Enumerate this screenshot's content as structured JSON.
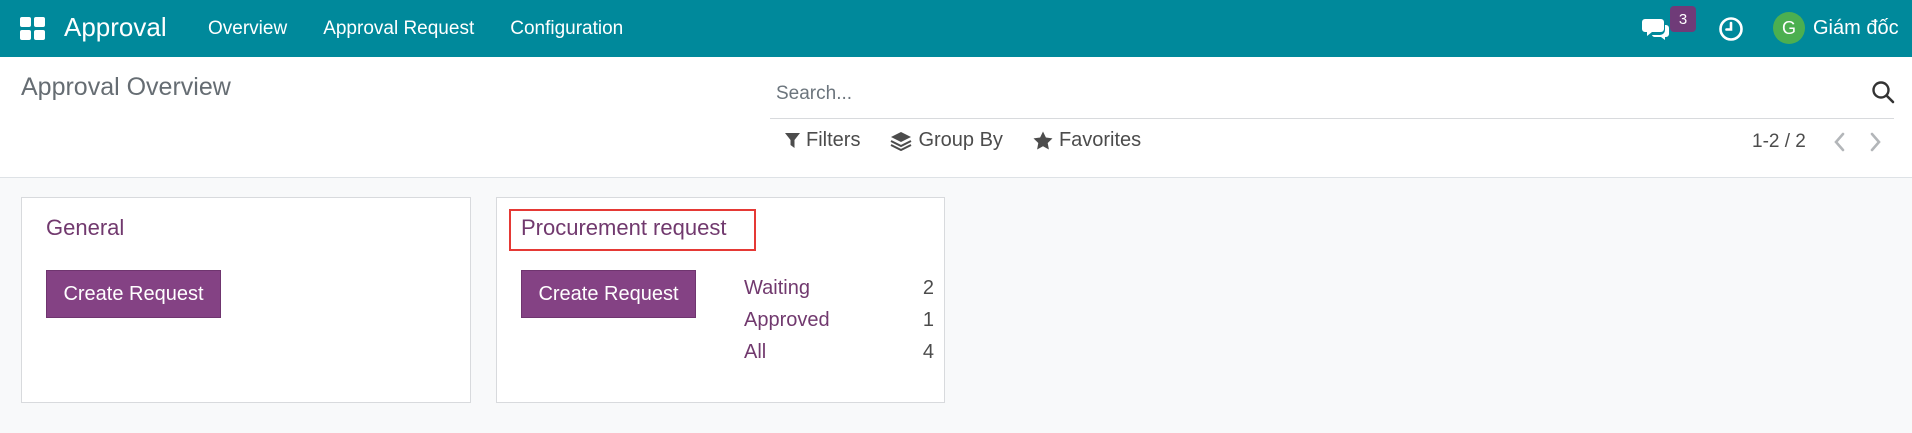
{
  "navbar": {
    "app_title": "Approval",
    "menu": [
      "Overview",
      "Approval Request",
      "Configuration"
    ],
    "chat_count": "3",
    "user_initial": "G",
    "user_name": "Giám đốc"
  },
  "control_panel": {
    "title": "Approval Overview",
    "search_placeholder": "Search...",
    "filters_label": "Filters",
    "groupby_label": "Group By",
    "favorites_label": "Favorites",
    "pager": "1-2 / 2"
  },
  "cards": [
    {
      "title": "General",
      "button_label": "Create Request",
      "stats": []
    },
    {
      "title": "Procurement request",
      "button_label": "Create Request",
      "stats": [
        {
          "label": "Waiting",
          "value": "2"
        },
        {
          "label": "Approved",
          "value": "1"
        },
        {
          "label": "All",
          "value": "4"
        }
      ]
    }
  ],
  "colors": {
    "navbar": "#00899b",
    "accent": "#71396e",
    "button": "#844284",
    "highlight": "#e53935"
  },
  "icons": [
    "apps-grid-icon",
    "chat-icon",
    "clock-icon",
    "search-icon",
    "filter-icon",
    "layers-icon",
    "star-icon",
    "chevron-left-icon",
    "chevron-right-icon"
  ]
}
